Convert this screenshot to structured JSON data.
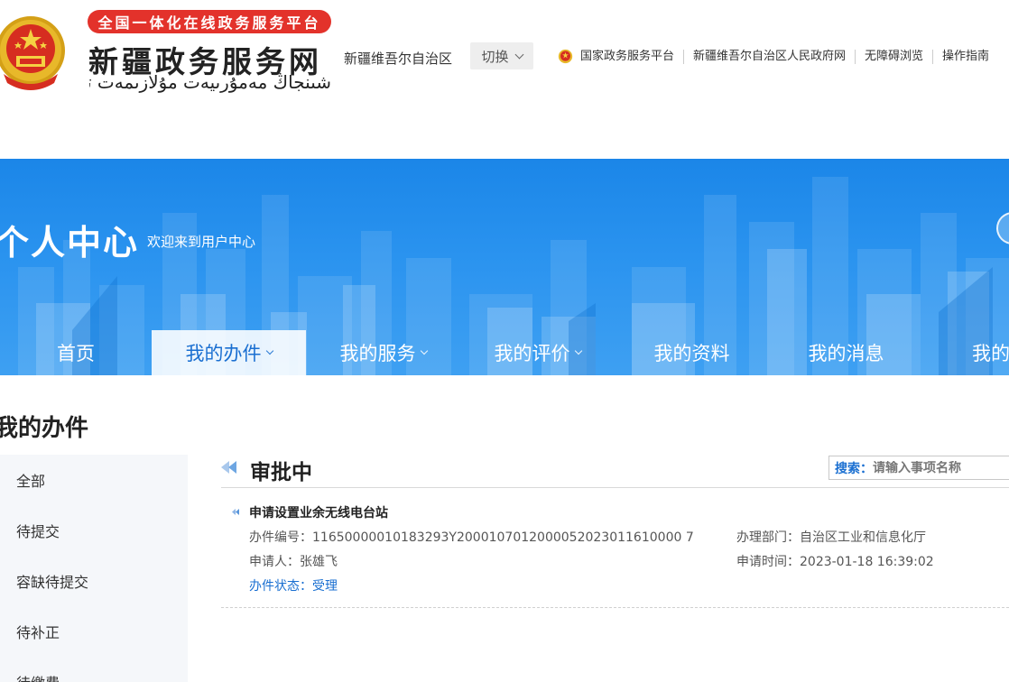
{
  "header": {
    "badge": "全国一体化在线政务服务平台",
    "site_title": "新疆政务服务网",
    "site_subtitle": "شىنجاڭ مەمۇرىيەت مۇلازىمەت تورى",
    "region": "新疆维吾尔自治区",
    "switch_label": "切换",
    "links": [
      "国家政务服务平台",
      "新疆维吾尔自治区人民政府网",
      "无障碍浏览",
      "操作指南"
    ]
  },
  "banner": {
    "title": "个人中心",
    "subtitle": "欢迎来到用户中心"
  },
  "nav": {
    "items": [
      {
        "label": "首页",
        "dropdown": false,
        "active": false
      },
      {
        "label": "我的办件",
        "dropdown": true,
        "active": true
      },
      {
        "label": "我的服务",
        "dropdown": true,
        "active": false
      },
      {
        "label": "我的评价",
        "dropdown": true,
        "active": false
      },
      {
        "label": "我的资料",
        "dropdown": false,
        "active": false
      },
      {
        "label": "我的消息",
        "dropdown": false,
        "active": false
      },
      {
        "label": "我的照",
        "dropdown": false,
        "active": false
      }
    ]
  },
  "page": {
    "heading": "我的办件"
  },
  "sidebar": {
    "items": [
      "全部",
      "待提交",
      "容缺待提交",
      "待补正",
      "待缴费"
    ]
  },
  "section": {
    "title": "审批中",
    "search_label": "搜索：",
    "search_placeholder": "请输入事项名称"
  },
  "record": {
    "title": "申请设置业余无线电台站",
    "number_label": "办件编号：",
    "number": "11650000010183293Y2000107012000052023011610000 7",
    "dept_label": "办理部门：",
    "dept": "自治区工业和信息化厅",
    "applicant_label": "申请人：",
    "applicant": "张雄飞",
    "time_label": "申请时间：",
    "time": "2023-01-18 16:39:02",
    "status_label": "办件状态：",
    "status": "受理"
  },
  "colors": {
    "brand_blue": "#1a6fd1",
    "banner_blue": "#2a93ef",
    "badge_red": "#e3322b",
    "sidebar_bg": "#f5f7fa"
  }
}
